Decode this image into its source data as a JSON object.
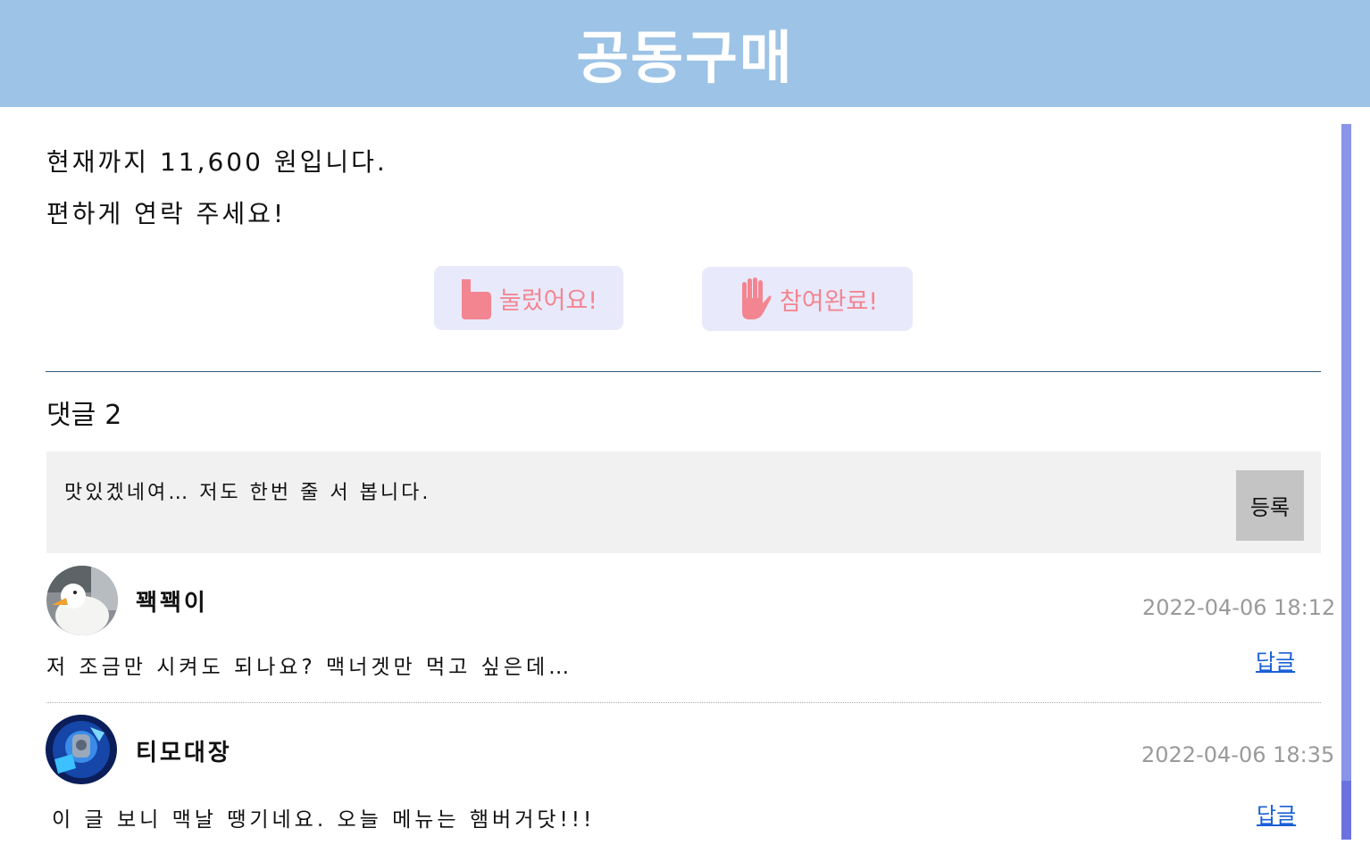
{
  "header": {
    "title": "공동구매"
  },
  "post": {
    "line1": "현재까지 11,600 원입니다.",
    "line2": "편하게 연락 주세요!"
  },
  "actions": {
    "like_label": "눌렀어요!",
    "join_label": "참여완료!",
    "like_icon": "thumbs-up-icon",
    "join_icon": "raised-hand-icon",
    "accent_color": "#f38591"
  },
  "comments": {
    "title": "댓글",
    "count": "2",
    "input_value": "맛있겠네여… 저도 한번 줄 서 봅니다.",
    "submit_label": "등록",
    "items": [
      {
        "nickname": "꽥꽥이",
        "timestamp": "2022-04-06 18:12",
        "text": "저 조금만 시켜도 되나요? 맥너겟만 먹고 싶은데…",
        "reply_label": "답글",
        "avatar": "duck-avatar"
      },
      {
        "nickname": "티모대장",
        "timestamp": "2022-04-06 18:35",
        "text": "이 글 보니 맥날 땡기네요. 오늘 메뉴는 햄버거닷!!!",
        "reply_label": "답글",
        "avatar": "game-character-avatar"
      }
    ]
  }
}
